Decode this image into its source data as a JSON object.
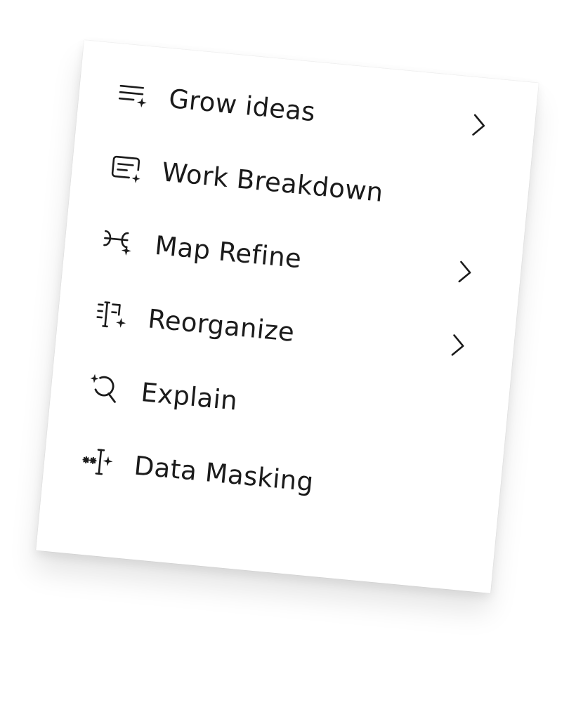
{
  "menu": {
    "items": [
      {
        "label": "Grow ideas",
        "icon": "grow-ideas-icon",
        "has_submenu": true
      },
      {
        "label": "Work Breakdown",
        "icon": "work-breakdown-icon",
        "has_submenu": false
      },
      {
        "label": "Map Refine",
        "icon": "map-refine-icon",
        "has_submenu": true
      },
      {
        "label": "Reorganize",
        "icon": "reorganize-icon",
        "has_submenu": true
      },
      {
        "label": "Explain",
        "icon": "explain-icon",
        "has_submenu": false
      },
      {
        "label": "Data Masking",
        "icon": "data-masking-icon",
        "has_submenu": false
      }
    ]
  },
  "colors": {
    "text": "#1b1b1b",
    "background": "#ffffff"
  }
}
